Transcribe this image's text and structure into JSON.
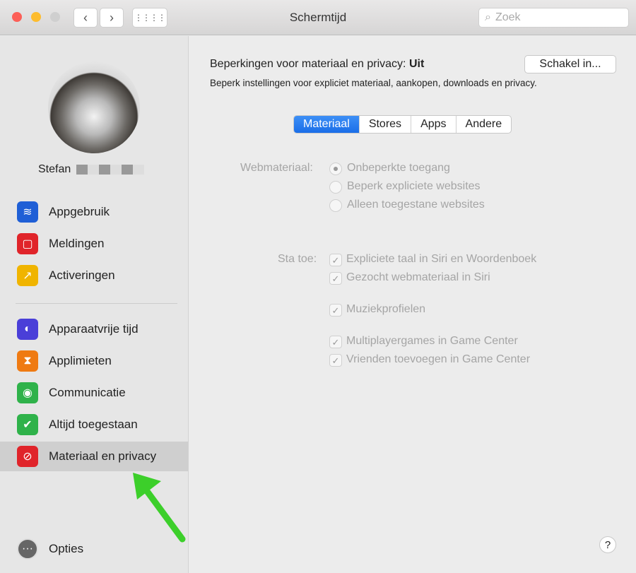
{
  "window": {
    "title": "Schermtijd",
    "search_placeholder": "Zoek"
  },
  "user": {
    "name": "Stefan"
  },
  "sidebar": {
    "items": [
      {
        "label": "Appgebruik",
        "icon": "layers-icon",
        "color": "#1f5fd6"
      },
      {
        "label": "Meldingen",
        "icon": "notification-icon",
        "color": "#e0242a"
      },
      {
        "label": "Activeringen",
        "icon": "pickup-icon",
        "color": "#f0b400"
      },
      {
        "label": "Apparaatvrije tijd",
        "icon": "downtime-icon",
        "color": "#4a3fd8"
      },
      {
        "label": "Applimieten",
        "icon": "hourglass-icon",
        "color": "#ef7a12"
      },
      {
        "label": "Communicatie",
        "icon": "contact-icon",
        "color": "#2fb24a"
      },
      {
        "label": "Altijd toegestaan",
        "icon": "checkmark-badge-icon",
        "color": "#2fb24a"
      },
      {
        "label": "Materiaal en privacy",
        "icon": "restriction-icon",
        "color": "#e0242a",
        "selected": true
      }
    ],
    "options": "Opties"
  },
  "main": {
    "header_label": "Beperkingen voor materiaal en privacy:",
    "header_state": "Uit",
    "subtitle": "Beperk instellingen voor expliciet materiaal, aankopen, downloads en privacy.",
    "enable_button": "Schakel in...",
    "tabs": [
      {
        "label": "Materiaal",
        "active": true
      },
      {
        "label": "Stores"
      },
      {
        "label": "Apps"
      },
      {
        "label": "Andere"
      }
    ],
    "web_label": "Webmateriaal:",
    "web_options": [
      {
        "label": "Onbeperkte toegang",
        "selected": true
      },
      {
        "label": "Beperk expliciete websites"
      },
      {
        "label": "Alleen toegestane websites"
      }
    ],
    "allow_label": "Sta toe:",
    "allow_options": [
      {
        "label": "Expliciete taal in Siri en Woordenboek",
        "checked": true
      },
      {
        "label": "Gezocht webmateriaal in Siri",
        "checked": true
      },
      {
        "label": "Muziekprofielen",
        "checked": true
      },
      {
        "label": "Multiplayergames in Game Center",
        "checked": true
      },
      {
        "label": "Vrienden toevoegen in Game Center",
        "checked": true
      }
    ],
    "help": "?"
  },
  "annotation": {
    "arrow_color": "#3ccf2a"
  }
}
